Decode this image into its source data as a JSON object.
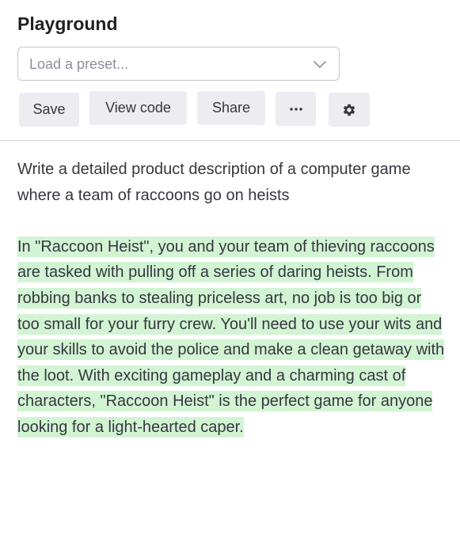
{
  "header": {
    "title": "Playground",
    "preset_placeholder": "Load a preset...",
    "buttons": {
      "save": "Save",
      "view_code": "View code",
      "share": "Share"
    },
    "icons": {
      "more": "more-dots-icon",
      "settings": "gear-icon",
      "dropdown": "chevron-down-icon"
    }
  },
  "editor": {
    "prompt": "Write a detailed product description of a computer game where a team of raccoons go on heists",
    "completion": "In \"Raccoon Heist\", you and your team of thieving raccoons are tasked with pulling off a series of daring heists. From robbing banks to stealing priceless art, no job is too big or too small for your furry crew. You'll need to use your wits and your skills to avoid the police and make a clean getaway with the loot. With exciting gameplay and a charming cast of characters, \"Raccoon Heist\" is the perfect game for anyone looking for a light-hearted caper."
  },
  "colors": {
    "completion_highlight": "#d2f4d3",
    "button_bg": "#ececf1",
    "text": "#353740"
  }
}
